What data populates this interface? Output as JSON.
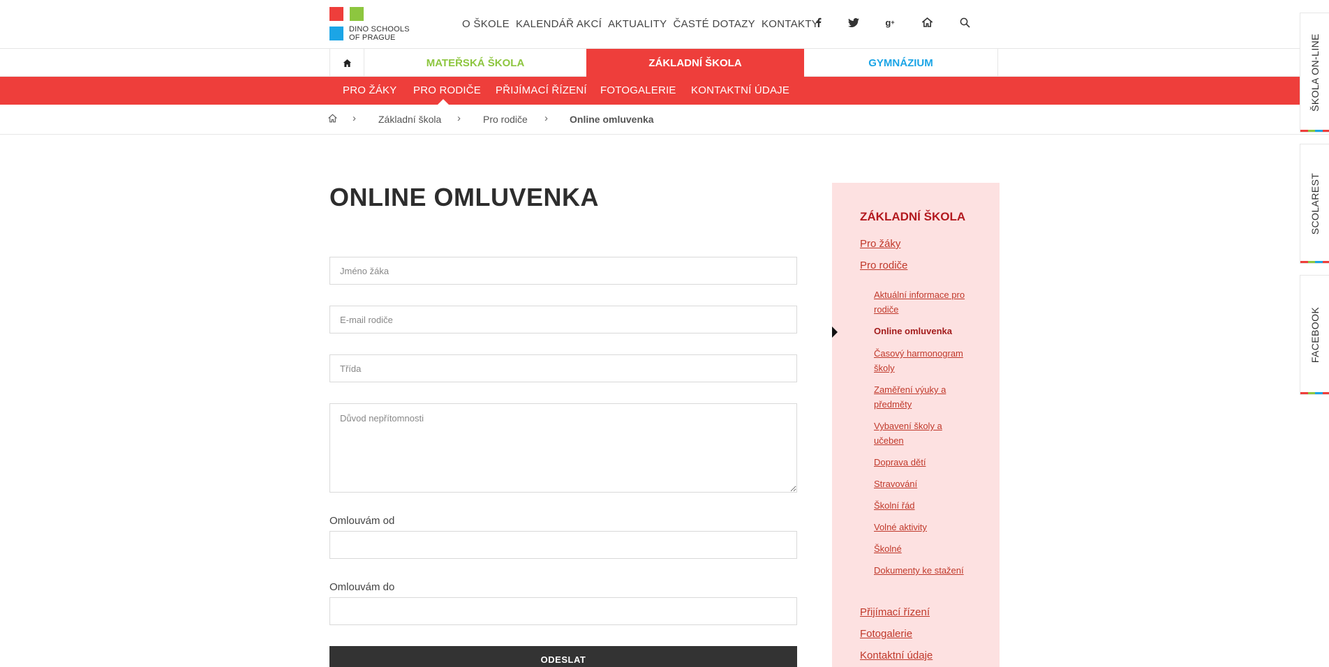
{
  "colors": {
    "red": "#ee3e3b",
    "green": "#8dc63f",
    "blue": "#1ba5e6",
    "dark": "#333333",
    "sidebar_bg": "#fde1e1"
  },
  "logo": {
    "line1": "DINO SCHOOLS",
    "line2": "OF PRAGUE"
  },
  "topnav": [
    "O ŠKOLE",
    "KALENDÁŘ AKCÍ",
    "AKTUALITY",
    "ČASTÉ DOTAZY",
    "KONTAKTY"
  ],
  "social_icons": [
    "facebook-icon",
    "twitter-icon",
    "google-plus-icon",
    "home-icon",
    "search-icon"
  ],
  "tabs": {
    "ms": "MATEŘSKÁ ŠKOLA",
    "zs": "ZÁKLADNÍ ŠKOLA",
    "gym": "GYMNÁZIUM"
  },
  "subnav": [
    "PRO ŽÁKY",
    "PRO RODIČE",
    "PŘIJÍMACÍ ŘÍZENÍ",
    "FOTOGALERIE",
    "KONTAKTNÍ ÚDAJE"
  ],
  "breadcrumb": [
    "Základní škola",
    "Pro rodiče",
    "Online omluvenka"
  ],
  "page_title": "ONLINE OMLUVENKA",
  "form": {
    "name_placeholder": "Jméno žáka",
    "email_placeholder": "E-mail rodiče",
    "class_placeholder": "Třída",
    "reason_placeholder": "Důvod nepřítomnosti",
    "from_label": "Omlouvám od",
    "to_label": "Omlouvám do",
    "submit_label": "ODESLAT"
  },
  "sidebar": {
    "title": "ZÁKLADNÍ ŠKOLA",
    "pro_zaky": "Pro žáky",
    "pro_rodice": "Pro rodiče",
    "sub": [
      "Aktuální informace pro rodiče",
      "Online omluvenka",
      "Časový harmonogram školy",
      "Zaměření výuky a předměty",
      "Vybavení školy a učeben",
      "Doprava dětí",
      "Stravování",
      "Školní řád",
      "Volné aktivity",
      "Školné",
      "Dokumenty ke stažení"
    ],
    "prijimaci": "Přijímací řízení",
    "fotogalerie": "Fotogalerie",
    "kontakty": "Kontaktní údaje"
  },
  "side_tabs": [
    "ŠKOLA ON-LINE",
    "SCOLAREST",
    "FACEBOOK"
  ]
}
